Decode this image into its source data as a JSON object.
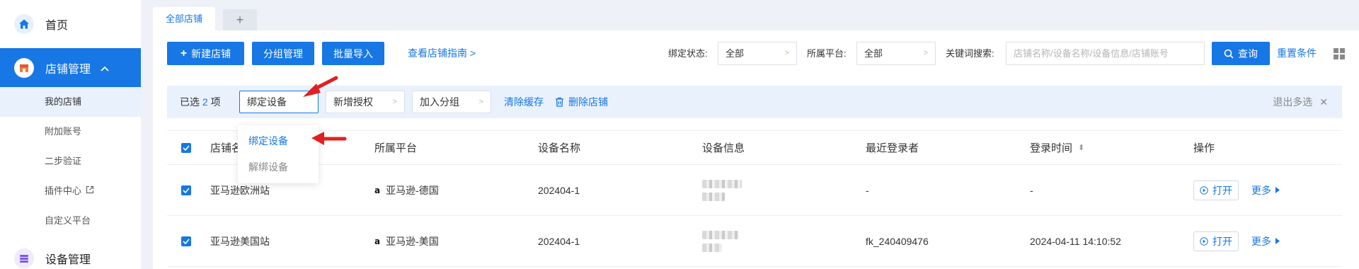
{
  "sidebar": {
    "home_label": "首页",
    "store_mgmt_label": "店铺管理",
    "sub_items": [
      {
        "label": "我的店铺",
        "active": true
      },
      {
        "label": "附加账号",
        "active": false
      },
      {
        "label": "二步验证",
        "active": false
      },
      {
        "label": "插件中心",
        "active": false
      },
      {
        "label": "自定义平台",
        "active": false
      }
    ],
    "device_mgmt_label": "设备管理"
  },
  "tabs": {
    "all_stores": "全部店铺",
    "add": "+"
  },
  "toolbar": {
    "new_store": "新建店铺",
    "group_mgmt": "分组管理",
    "batch_import": "批量导入",
    "guide_link": "查看店铺指南 >"
  },
  "filters": {
    "bind_status_label": "绑定状态:",
    "bind_status_value": "全部",
    "platform_label": "所属平台:",
    "platform_value": "全部",
    "keyword_label": "关键词搜索:",
    "keyword_placeholder": "店铺名称/设备名称/设备信息/店铺账号",
    "query_button": "查询",
    "reset_link": "重置条件"
  },
  "selection_bar": {
    "selected_prefix": "已选",
    "selected_count": "2",
    "selected_suffix": "项",
    "bind_device": "绑定设备",
    "add_auth": "新增授权",
    "join_group": "加入分组",
    "clear_cache": "清除缓存",
    "delete_store": "删除店铺",
    "exit_multi": "退出多选"
  },
  "dropdown": {
    "items": [
      "绑定设备",
      "解绑设备"
    ]
  },
  "table": {
    "headers": {
      "store": "店铺名",
      "platform": "所属平台",
      "device_name": "设备名称",
      "device_info": "设备信息",
      "last_login_user": "最近登录者",
      "login_time": "登录时间",
      "actions": "操作"
    },
    "rows": [
      {
        "store": "亚马逊欧洲站",
        "platform": "亚马逊-德国",
        "device_name": "202404-1",
        "last_login_user": "-",
        "login_time": "-",
        "open": "打开",
        "more": "更多"
      },
      {
        "store": "亚马逊美国站",
        "platform": "亚马逊-美国",
        "device_name": "202404-1",
        "last_login_user": "fk_240409476",
        "login_time": "2024-04-11 14:10:52",
        "open": "打开",
        "more": "更多"
      }
    ]
  },
  "colors": {
    "primary": "#1677e5",
    "sidebar_active": "#1677e5",
    "arrow": "#e02020"
  }
}
